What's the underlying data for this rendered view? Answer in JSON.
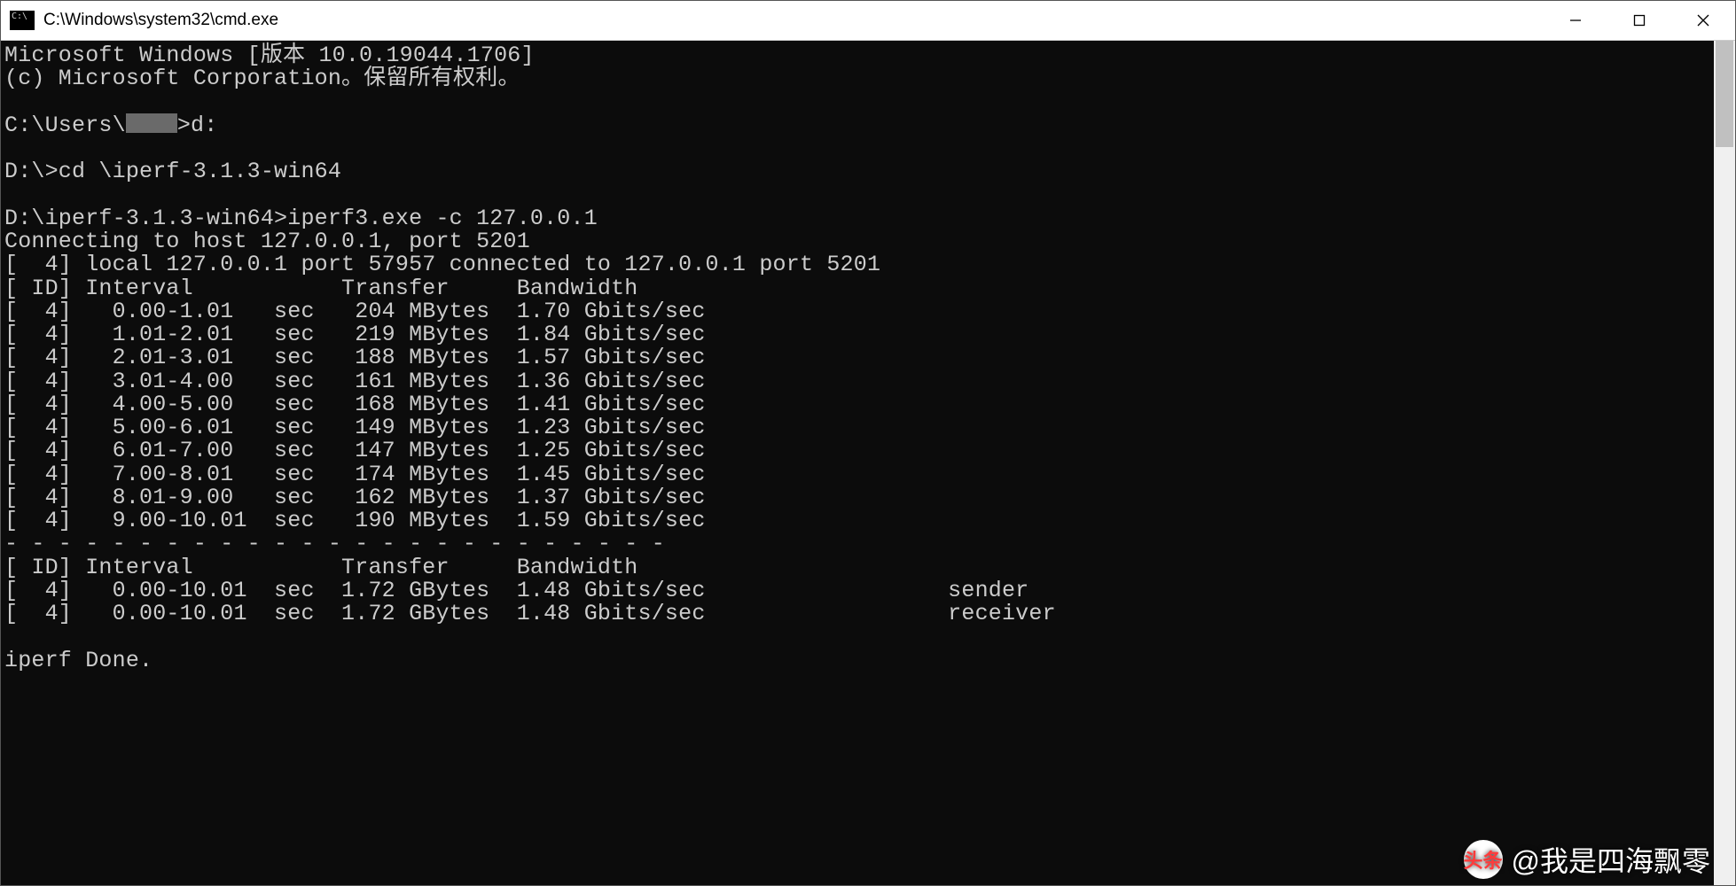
{
  "window": {
    "title": "C:\\Windows\\system32\\cmd.exe"
  },
  "console": {
    "header1": "Microsoft Windows [版本 10.0.19044.1706]",
    "header2": "(c) Microsoft Corporation。保留所有权利。",
    "prompt1_pre": "C:\\Users\\",
    "prompt1_post": ">d:",
    "prompt2": "D:\\>cd \\iperf-3.1.3-win64",
    "prompt3": "D:\\iperf-3.1.3-win64>iperf3.exe -c 127.0.0.1",
    "connecting": "Connecting to host 127.0.0.1, port 5201",
    "local": "[  4] local 127.0.0.1 port 57957 connected to 127.0.0.1 port 5201",
    "columns": "[ ID] Interval           Transfer     Bandwidth",
    "rows": [
      "[  4]   0.00-1.01   sec   204 MBytes  1.70 Gbits/sec",
      "[  4]   1.01-2.01   sec   219 MBytes  1.84 Gbits/sec",
      "[  4]   2.01-3.01   sec   188 MBytes  1.57 Gbits/sec",
      "[  4]   3.01-4.00   sec   161 MBytes  1.36 Gbits/sec",
      "[  4]   4.00-5.00   sec   168 MBytes  1.41 Gbits/sec",
      "[  4]   5.00-6.01   sec   149 MBytes  1.23 Gbits/sec",
      "[  4]   6.01-7.00   sec   147 MBytes  1.25 Gbits/sec",
      "[  4]   7.00-8.01   sec   174 MBytes  1.45 Gbits/sec",
      "[  4]   8.01-9.00   sec   162 MBytes  1.37 Gbits/sec",
      "[  4]   9.00-10.01  sec   190 MBytes  1.59 Gbits/sec"
    ],
    "sep": "- - - - - - - - - - - - - - - - - - - - - - - - -",
    "summary_header": "[ ID] Interval           Transfer     Bandwidth",
    "summary1": "[  4]   0.00-10.01  sec  1.72 GBytes  1.48 Gbits/sec                  sender",
    "summary2": "[  4]   0.00-10.01  sec  1.72 GBytes  1.48 Gbits/sec                  receiver",
    "done": "iperf Done."
  },
  "watermark": {
    "logo": "头条",
    "text": "@我是四海飘零"
  }
}
